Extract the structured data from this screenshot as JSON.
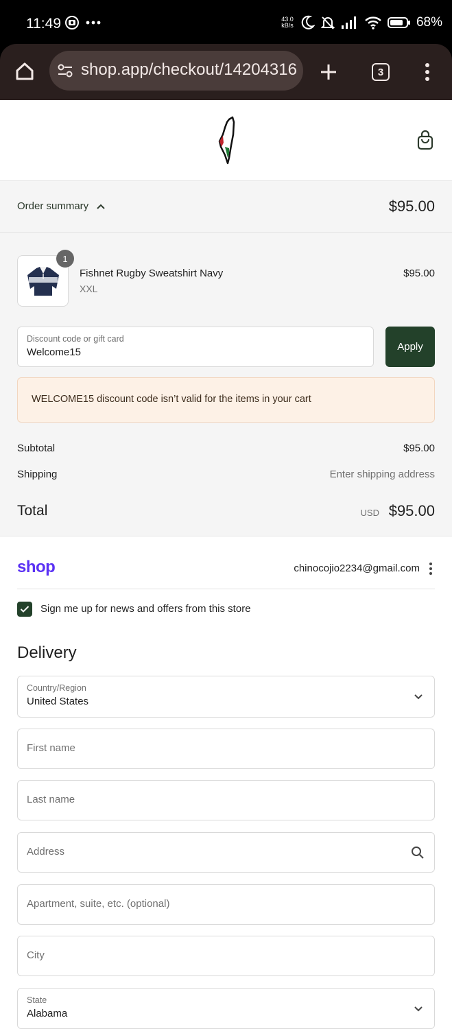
{
  "status_bar": {
    "time": "11:49",
    "net_speed_value": "43.0",
    "net_speed_unit": "kB/s",
    "battery": "68%"
  },
  "browser": {
    "url": "shop.app/checkout/14204316",
    "tab_count": "3"
  },
  "order_summary": {
    "toggle_label": "Order summary",
    "total": "$95.00",
    "item": {
      "quantity": "1",
      "name": "Fishnet Rugby Sweatshirt Navy",
      "variant": "XXL",
      "price": "$95.00"
    },
    "discount": {
      "label": "Discount code or gift card",
      "value": "Welcome15",
      "apply_label": "Apply"
    },
    "error": "WELCOME15 discount code isn’t valid for the items in your cart",
    "subtotal_label": "Subtotal",
    "subtotal_value": "$95.00",
    "shipping_label": "Shipping",
    "shipping_value": "Enter shipping address",
    "total_label": "Total",
    "total_currency": "USD",
    "total_value": "$95.00"
  },
  "account": {
    "shop_logo": "shop",
    "email": "chinocojio2234@gmail.com",
    "newsletter_label": "Sign me up for news and offers from this store",
    "newsletter_checked": true
  },
  "delivery": {
    "heading": "Delivery",
    "country_label": "Country/Region",
    "country_value": "United States",
    "first_name_ph": "First name",
    "last_name_ph": "Last name",
    "address_ph": "Address",
    "apartment_ph": "Apartment, suite, etc. (optional)",
    "city_ph": "City",
    "state_label": "State",
    "state_value": "Alabama"
  },
  "colors": {
    "accent_green": "#23412a",
    "shop_purple": "#5a31f4",
    "error_bg": "#fdf1e6"
  }
}
